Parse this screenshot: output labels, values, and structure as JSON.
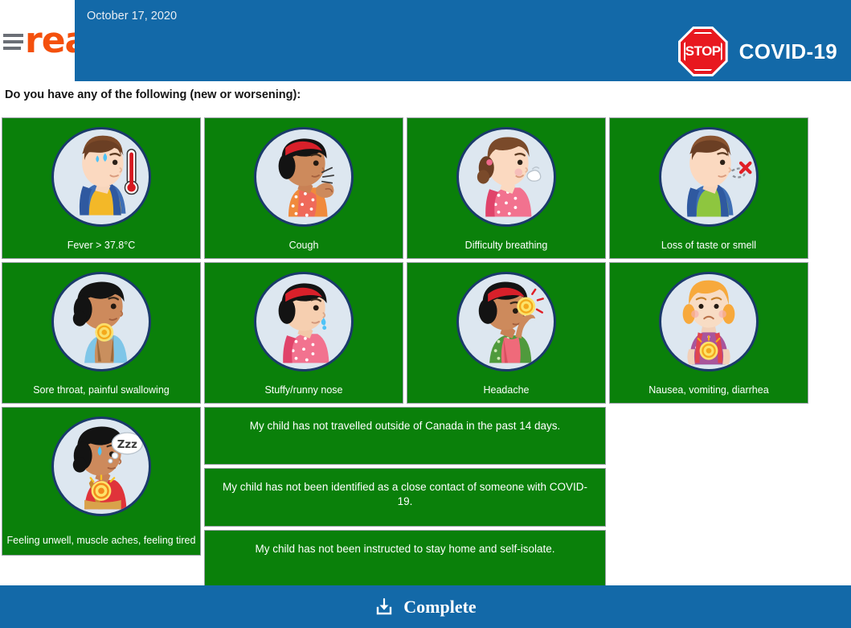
{
  "header": {
    "logo_text": "rea",
    "menu_icon": "hamburger-menu-icon",
    "date": "October 17, 2020",
    "stop_sign_label": "STOP",
    "covid_label": "COVID-19"
  },
  "main": {
    "question": "Do you have any of the following (new or worsening):",
    "symptoms": [
      {
        "label": "Fever > 37.8°C",
        "icon": "fever-thermometer-icon"
      },
      {
        "label": "Cough",
        "icon": "cough-icon"
      },
      {
        "label": "Difficulty breathing",
        "icon": "difficulty-breathing-icon"
      },
      {
        "label": "Loss of taste or smell",
        "icon": "loss-of-smell-icon"
      },
      {
        "label": "Sore throat, painful swallowing",
        "icon": "sore-throat-icon"
      },
      {
        "label": "Stuffy/runny nose",
        "icon": "runny-nose-icon"
      },
      {
        "label": "Headache",
        "icon": "headache-icon"
      },
      {
        "label": "Nausea, vomiting, diarrhea",
        "icon": "nausea-icon"
      },
      {
        "label": "Feeling unwell, muscle aches, feeling tired",
        "icon": "fatigue-icon"
      }
    ],
    "statements": [
      "My child has not travelled outside of Canada in the past 14 days.",
      "My child has not been identified as a close contact of someone with COVID-19.",
      "My child has not been instructed to stay home and self-isolate."
    ]
  },
  "footer": {
    "complete_label": "Complete",
    "complete_icon": "download-save-icon"
  },
  "colors": {
    "header_blue": "#1369a8",
    "tile_green": "#0a800a",
    "logo_orange": "#f4500d",
    "stop_red": "#e8181f",
    "avatar_bg": "#dde7f0",
    "avatar_ring": "#1b3a6b"
  }
}
